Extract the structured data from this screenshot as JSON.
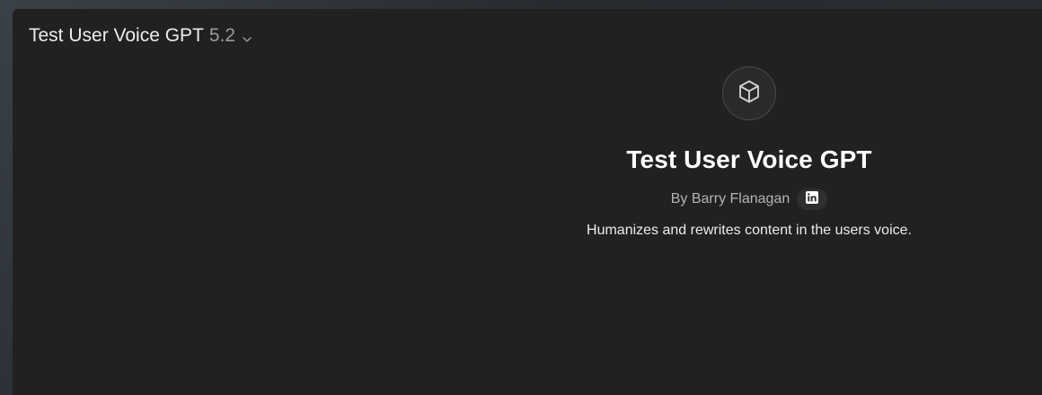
{
  "header": {
    "model_name": "Test User Voice GPT",
    "model_version": "5.2"
  },
  "gpt": {
    "icon": "cube-icon",
    "title": "Test User Voice GPT",
    "author": "By Barry Flanagan",
    "author_link_icon": "linkedin-icon",
    "description": "Humanizes and rewrites content in the users voice."
  },
  "colors": {
    "background": "#212121",
    "title": "#ffffff",
    "muted": "#b4b4b4"
  }
}
